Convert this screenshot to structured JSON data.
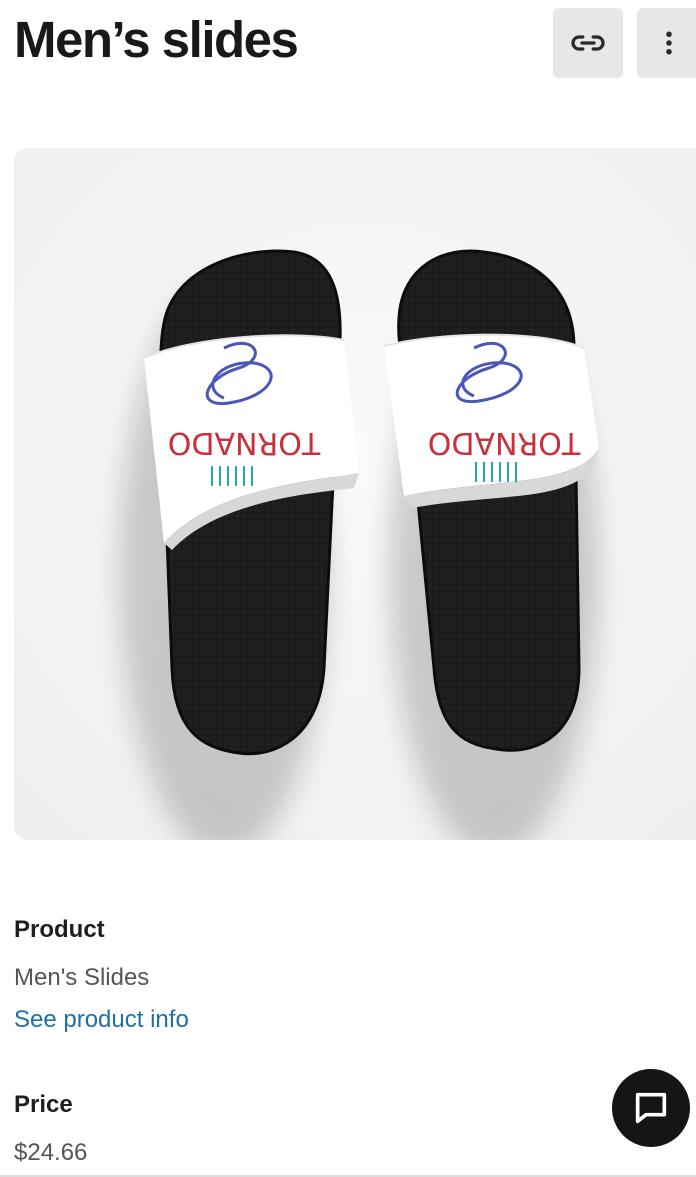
{
  "header": {
    "title": "Men’s slides",
    "link_button_icon": "link-icon",
    "more_button_icon": "more-vertical-icon"
  },
  "product_image": {
    "strap_text_left": "TORNADO",
    "strap_text_right": "TORNADO",
    "colors": {
      "sole": "#1b1b1b",
      "strap": "#ffffff",
      "text_red": "#c8303a",
      "swirl_blue": "#4a56b8",
      "ticks_teal": "#2aa3b0"
    }
  },
  "details": {
    "product_label": "Product",
    "product_value": "Men's Slides",
    "product_link": "See product info",
    "price_label": "Price",
    "price_value": "$24.66"
  },
  "chat": {
    "icon": "chat-bubble-icon"
  },
  "colors": {
    "link": "#1f6ea6",
    "button_bg": "#e7e7e7",
    "fab_bg": "#151515"
  }
}
